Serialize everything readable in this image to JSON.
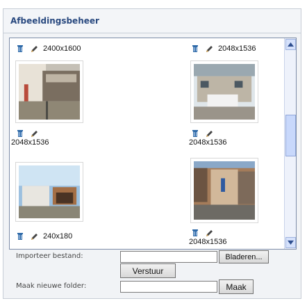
{
  "panel": {
    "title": "Afbeeldingsbeheer"
  },
  "images": [
    {
      "label": "2400x1600"
    },
    {
      "label": "2048x1536"
    },
    {
      "label": "2048x1536"
    },
    {
      "label": "2048x1536"
    },
    {
      "label": "240x180"
    },
    {
      "label": "2048x1536"
    }
  ],
  "icons": {
    "delete": "trash-icon",
    "edit": "pencil-icon"
  },
  "form": {
    "import_label": "Importeer bestand:",
    "browse_button": "Bladeren...",
    "submit_button": "Verstuur",
    "folder_label": "Maak nieuwe folder:",
    "create_button": "Maak"
  },
  "colors": {
    "title": "#2a4a80",
    "panel_bg": "#f1f3f6",
    "border": "#7d8da8"
  }
}
